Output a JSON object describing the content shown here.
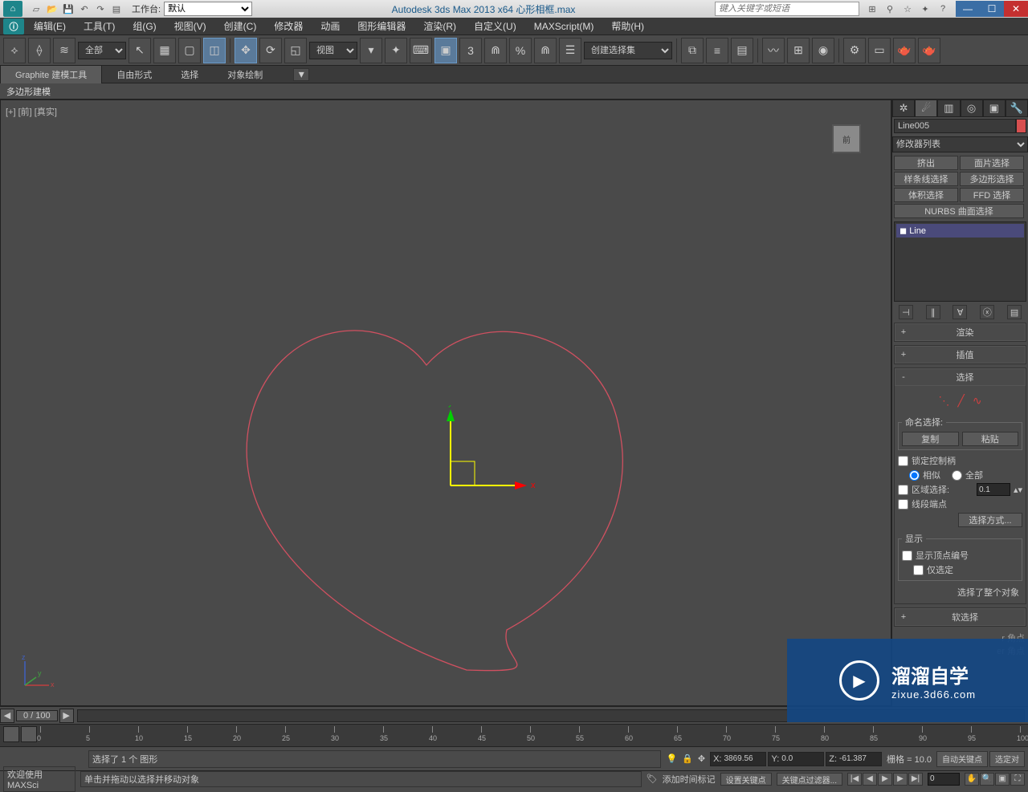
{
  "app": {
    "title": "Autodesk 3ds Max  2013 x64     心形相框.max",
    "workspace_label": "工作台:",
    "workspace_value": "默认",
    "search_placeholder": "键入关键字或短语"
  },
  "menubar": [
    "编辑(E)",
    "工具(T)",
    "组(G)",
    "视图(V)",
    "创建(C)",
    "修改器",
    "动画",
    "图形编辑器",
    "渲染(R)",
    "自定义(U)",
    "MAXScript(M)",
    "帮助(H)"
  ],
  "toolbar": {
    "layer_set": "全部",
    "view_set": "视图",
    "named_set": "创建选择集"
  },
  "ribbon": {
    "tabs": [
      "Graphite 建模工具",
      "自由形式",
      "选择",
      "对象绘制"
    ],
    "active": 0,
    "sublabel": "多边形建模"
  },
  "viewport": {
    "label": "[+] [前] [真实]",
    "cube_face": "前"
  },
  "cmdpanel": {
    "object_name": "Line005",
    "modifier_placeholder": "修改器列表",
    "mod_buttons": [
      "挤出",
      "面片选择",
      "样条线选择",
      "多边形选择",
      "体积选择",
      "FFD 选择"
    ],
    "mod_wide": "NURBS 曲面选择",
    "stack_item": "Line",
    "rollouts": {
      "render": "渲染",
      "interp": "插值",
      "select": "选择",
      "soft": "软选择"
    },
    "select_body": {
      "named_sel": "命名选择:",
      "copy": "复制",
      "paste": "粘贴",
      "lock_handles": "锁定控制柄",
      "similar": "相似",
      "all": "全部",
      "area_sel": "区域选择:",
      "area_val": "0.1",
      "seg_end": "线段端点",
      "sel_method": "选择方式...",
      "display": "显示",
      "show_vtx_num": "显示顶点编号",
      "only_sel": "仅选定",
      "whole_obj": "选择了整个对象"
    },
    "extra1": "r 角点",
    "extra2": "er 角点"
  },
  "timeline": {
    "frame_ind": "0 / 100",
    "ticks": [
      0,
      5,
      10,
      15,
      20,
      25,
      30,
      35,
      40,
      45,
      50,
      55,
      60,
      65,
      70,
      75,
      80,
      85,
      90,
      95,
      100
    ]
  },
  "status": {
    "sel_msg": "选择了 1 个 图形",
    "x": "3869.56",
    "y": "0.0",
    "z": "-61.387",
    "grid": "栅格 = 10.0",
    "auto_key": "自动关键点",
    "sel_obj": "选定对"
  },
  "status2": {
    "greet": "欢迎使用  MAXSci",
    "hint": "单击并拖动以选择并移动对象",
    "add_time": "添加时间标记",
    "set_key": "设置关键点",
    "key_filter": "关键点过滤器...",
    "frame_val": "0"
  },
  "watermark": {
    "big": "溜溜自学",
    "small": "zixue.3d66.com"
  }
}
